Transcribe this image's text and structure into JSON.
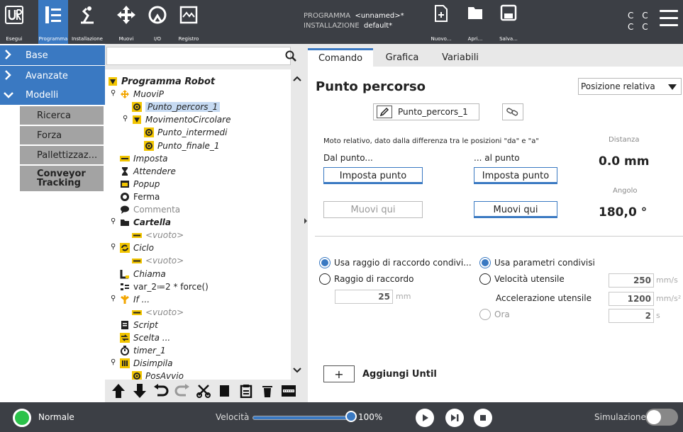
{
  "topbar": {
    "buttons": [
      {
        "label": "Esegui",
        "icon": "ur-logo-icon"
      },
      {
        "label": "Programma",
        "icon": "program-icon"
      },
      {
        "label": "Installazione",
        "icon": "installation-icon"
      },
      {
        "label": "Muovi",
        "icon": "move-icon"
      },
      {
        "label": "I/O",
        "icon": "io-icon"
      },
      {
        "label": "Registro",
        "icon": "log-icon"
      }
    ],
    "program_label": "PROGRAMMA",
    "program_value": "<unnamed>*",
    "installation_label": "INSTALLAZIONE",
    "installation_value": "default*",
    "file_buttons": [
      {
        "label": "Nuovo...",
        "icon": "new-file-icon"
      },
      {
        "label": "Apri...",
        "icon": "folder-icon"
      },
      {
        "label": "Salva...",
        "icon": "save-icon"
      }
    ],
    "cc_line1": "C C",
    "cc_line2": "C C"
  },
  "leftnav": {
    "sections": [
      {
        "label": "Base",
        "expanded": false
      },
      {
        "label": "Avanzate",
        "expanded": false
      },
      {
        "label": "Modelli",
        "expanded": true
      }
    ],
    "sub_items": [
      "Ricerca",
      "Forza",
      "Pallettizzaz...",
      "Conveyor Tracking"
    ]
  },
  "tree": {
    "search_placeholder": "",
    "rows": [
      {
        "label": "Programma Robot",
        "level": 0,
        "style": "bold-italic",
        "icon": "triangle-icon"
      },
      {
        "label": "MuoviP",
        "level": 1,
        "style": "italic",
        "icon": "move-icon"
      },
      {
        "label": "Punto_percors_1",
        "level": 2,
        "style": "italic",
        "icon": "waypoint-icon",
        "selected": true
      },
      {
        "label": "MovimentoCircolare",
        "level": 2,
        "style": "italic",
        "icon": "triangle-icon"
      },
      {
        "label": "Punto_intermedi",
        "level": 3,
        "style": "italic",
        "icon": "waypoint-icon"
      },
      {
        "label": "Punto_finale_1",
        "level": 3,
        "style": "italic",
        "icon": "waypoint-icon"
      },
      {
        "label": "Imposta",
        "level": 1,
        "style": "italic",
        "icon": "set-icon"
      },
      {
        "label": "Attendere",
        "level": 1,
        "style": "italic",
        "icon": "hourglass-icon"
      },
      {
        "label": "Popup",
        "level": 1,
        "style": "italic",
        "icon": "popup-icon"
      },
      {
        "label": "Ferma",
        "level": 1,
        "style": "normal",
        "icon": "stop-icon"
      },
      {
        "label": "Commenta",
        "level": 1,
        "style": "grey",
        "icon": "comment-icon"
      },
      {
        "label": "Cartella",
        "level": 1,
        "style": "bold-italic",
        "icon": "folder-icon"
      },
      {
        "label": "<vuoto>",
        "level": 2,
        "style": "grey-italic",
        "icon": "empty-icon"
      },
      {
        "label": "Ciclo",
        "level": 1,
        "style": "italic",
        "icon": "loop-icon"
      },
      {
        "label": "<vuoto>",
        "level": 2,
        "style": "grey-italic",
        "icon": "empty-icon"
      },
      {
        "label": "Chiama",
        "level": 1,
        "style": "italic",
        "icon": "call-icon"
      },
      {
        "label": "var_2≔2 * force()",
        "level": 1,
        "style": "normal",
        "icon": "assign-icon"
      },
      {
        "label": "If ...",
        "level": 1,
        "style": "italic",
        "icon": "if-icon"
      },
      {
        "label": "<vuoto>",
        "level": 2,
        "style": "grey-italic",
        "icon": "empty-icon"
      },
      {
        "label": "Script",
        "level": 1,
        "style": "italic",
        "icon": "script-icon"
      },
      {
        "label": "Scelta ...",
        "level": 1,
        "style": "italic",
        "icon": "switch-icon"
      },
      {
        "label": "timer_1",
        "level": 1,
        "style": "italic",
        "icon": "timer-icon"
      },
      {
        "label": "Disimpila",
        "level": 1,
        "style": "italic",
        "icon": "unstack-icon"
      },
      {
        "label": "PosAvvio",
        "level": 2,
        "style": "italic",
        "icon": "waypoint-icon"
      }
    ],
    "toolbar": [
      "arrow-up-icon",
      "arrow-down-icon",
      "undo-icon",
      "redo-icon",
      "cut-icon",
      "copy-icon",
      "paste-icon",
      "delete-icon",
      "suppress-icon"
    ]
  },
  "tabs": [
    "Comando",
    "Grafica",
    "Variabili"
  ],
  "waypoint": {
    "title": "Punto percorso",
    "position_mode": "Posizione relativa",
    "name": "Punto_percors_1",
    "description": "Moto relativo, dato dalla differenza tra le posizioni \"da\" e \"a\"",
    "distance_label": "Distanza",
    "distance_value": "0.0 mm",
    "angle_label": "Angolo",
    "angle_value": "180,0 °",
    "from_label": "Dal punto...",
    "to_label": "... al punto",
    "set_point_from": "Imposta punto",
    "set_point_to": "Imposta punto",
    "move_here_from": "Muovi qui",
    "move_here_to": "Muovi qui"
  },
  "blend": {
    "shared_label": "Usa raggio di raccordo condivi...",
    "shared_selected": true,
    "radius_label": "Raggio di raccordo",
    "radius_value": "25",
    "radius_unit": "mm"
  },
  "params": {
    "shared_label": "Usa parametri condivisi",
    "shared_selected": true,
    "tool_speed_label": "Velocità utensile",
    "tool_speed_value": "250",
    "tool_speed_unit": "mm/s",
    "tool_accel_label": "Accelerazione utensile",
    "tool_accel_value": "1200",
    "tool_accel_unit": "mm/s²",
    "time_label": "Ora",
    "time_value": "2",
    "time_unit": "s"
  },
  "until": {
    "label": "Aggiungi Until",
    "plus": "+"
  },
  "bottombar": {
    "status": "Normale",
    "speed_label": "Velocità",
    "speed_value": "100%",
    "speed_fraction": 1.0,
    "simulation_label": "Simulazione"
  },
  "colors": {
    "accent": "#3a79c2",
    "bar": "#3c3f45",
    "status_ok": "#2bc24a",
    "tree_icon_yellow": "#f2c500"
  }
}
